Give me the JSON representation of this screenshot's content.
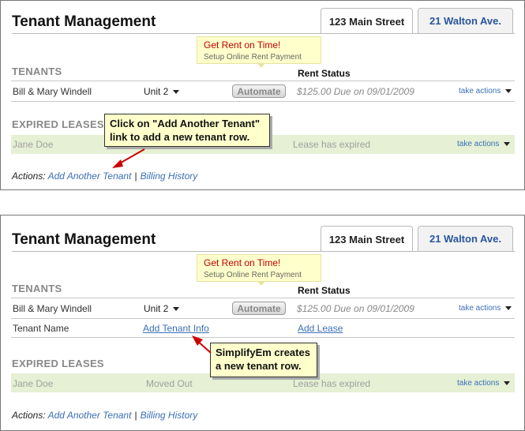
{
  "panels": [
    {
      "title": "Tenant Management",
      "tabs": [
        {
          "label": "123 Main Street"
        },
        {
          "label": "21 Walton Ave."
        }
      ],
      "promo": {
        "line1": "Get Rent on Time!",
        "line2": "Setup Online Rent Payment"
      },
      "tenants_header": "TENANTS",
      "rent_status_header": "Rent Status",
      "tenant_row": {
        "name": "Bill & Mary Windell",
        "unit": "Unit 2",
        "automate": "Automate",
        "status": "$125.00 Due on 09/01/2009",
        "actions": "take actions"
      },
      "expired_header": "EXPIRED LEASES",
      "expired_row": {
        "name": "Jane Doe",
        "status": "Lease has expired",
        "actions": "take actions"
      },
      "actions_label": "Actions:",
      "add_tenant_link": "Add Another Tenant",
      "separator": "|",
      "billing_link": "Billing History",
      "callout": {
        "line1": "Click on \"Add Another Tenant\"",
        "line2": "link to add a new tenant row."
      }
    },
    {
      "title": "Tenant Management",
      "tabs": [
        {
          "label": "123 Main Street"
        },
        {
          "label": "21 Walton Ave."
        }
      ],
      "promo": {
        "line1": "Get Rent on Time!",
        "line2": "Setup Online Rent Payment"
      },
      "tenants_header": "TENANTS",
      "rent_status_header": "Rent Status",
      "tenant_row": {
        "name": "Bill & Mary Windell",
        "unit": "Unit 2",
        "automate": "Automate",
        "status": "$125.00 Due on 09/01/2009",
        "actions": "take actions"
      },
      "new_row": {
        "name": "Tenant Name",
        "add_info": "Add Tenant Info",
        "add_lease": "Add Lease"
      },
      "expired_header": "EXPIRED LEASES",
      "expired_row": {
        "name": "Jane Doe",
        "moved": "Moved Out",
        "status": "Lease has expired",
        "actions": "take actions"
      },
      "actions_label": "Actions:",
      "add_tenant_link": "Add Another Tenant",
      "separator": "|",
      "billing_link": "Billing History",
      "callout": {
        "line1": "SimplifyEm creates",
        "line2": "a new tenant row."
      }
    }
  ]
}
